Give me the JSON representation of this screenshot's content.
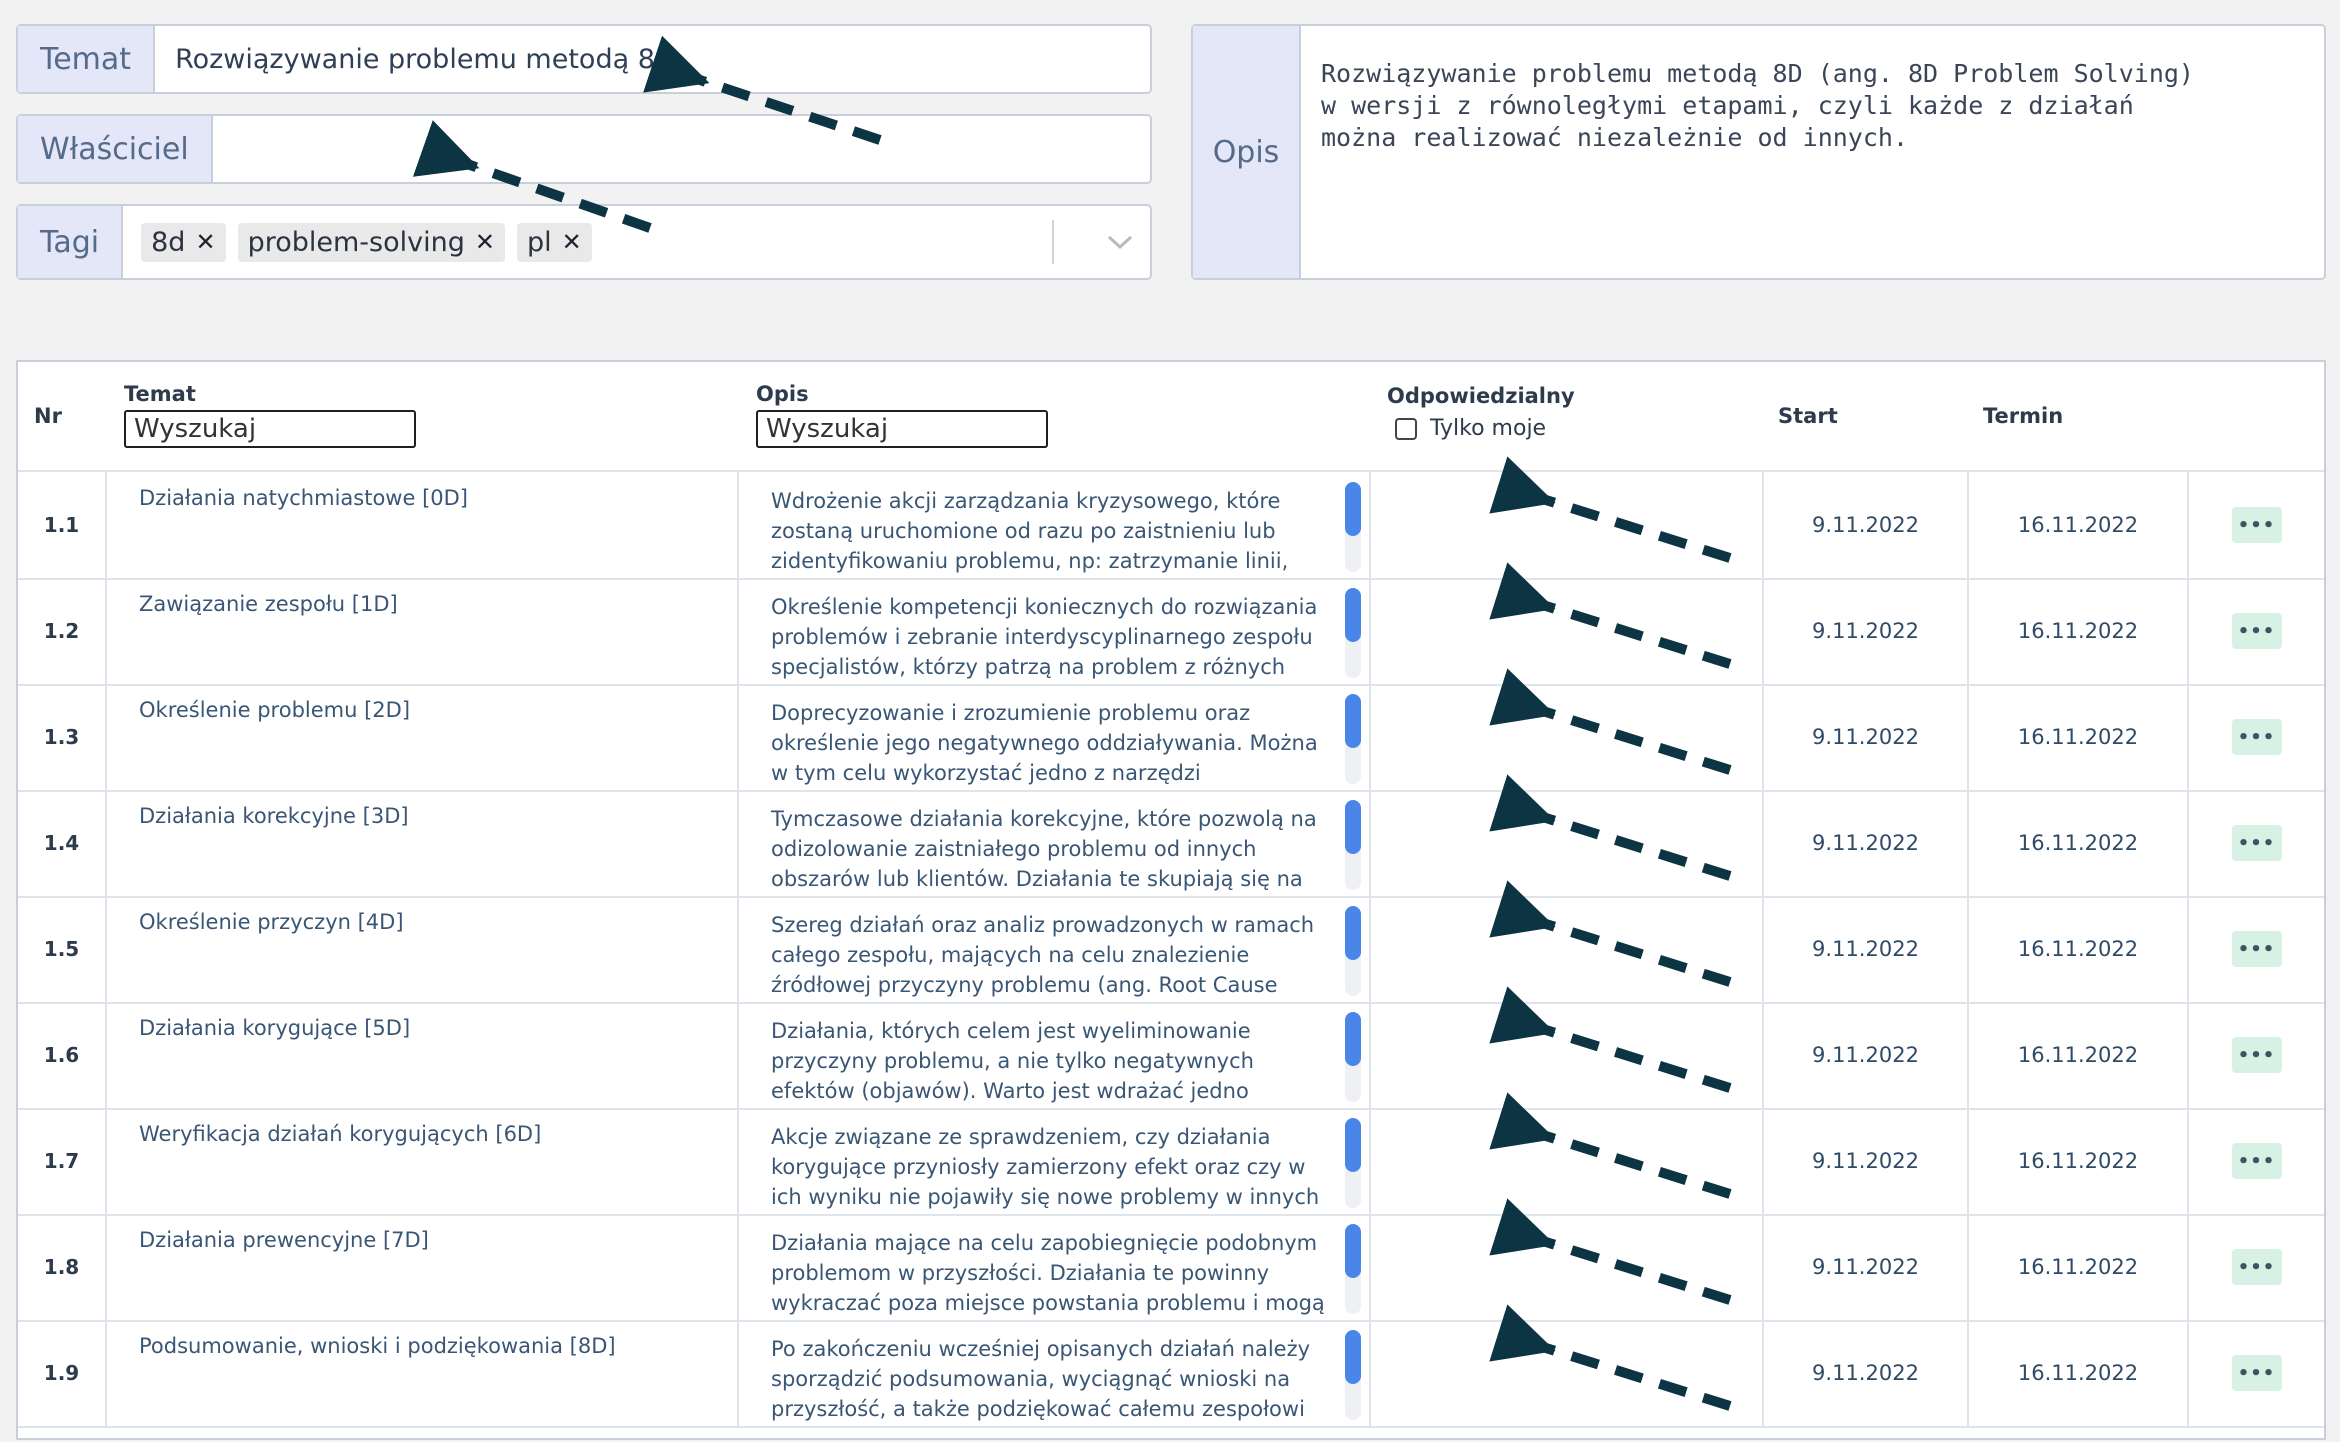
{
  "form": {
    "temat_label": "Temat",
    "temat_value": "Rozwiązywanie problemu metodą 8D",
    "wlasciciel_label": "Właściciel",
    "wlasciciel_value": "",
    "tagi_label": "Tagi",
    "tags": [
      "8d",
      "problem-solving",
      "pl"
    ],
    "opis_label": "Opis",
    "opis_value": "Rozwiązywanie problemu metodą 8D (ang. 8D Problem Solving)\nw wersji z równoległymi etapami, czyli każde z działań\nmożna realizować niezależnie od innych."
  },
  "table": {
    "headers": {
      "nr": "Nr",
      "temat": "Temat",
      "opis": "Opis",
      "odpowiedzialny": "Odpowiedzialny",
      "tylko_moje": "Tylko moje",
      "start": "Start",
      "termin": "Termin"
    },
    "search_placeholder": "Wyszukaj",
    "action_label": "•••",
    "rows": [
      {
        "nr": "1.1",
        "temat": "Działania natychmiastowe [0D]",
        "opis": "Wdrożenie akcji zarządzania kryzysowego, które zostaną uruchomione od razu po zaistnieniu lub zidentyfikowaniu problemu, np: zatrzymanie linii, wstrzymanie wysyłek lub",
        "start": "9.11.2022",
        "termin": "16.11.2022"
      },
      {
        "nr": "1.2",
        "temat": "Zawiązanie zespołu [1D]",
        "opis": "Określenie kompetencji koniecznych do rozwiązania problemów i zebranie interdyscyplinarnego zespołu specjalistów, którzy patrzą na problem z różnych punktów",
        "start": "9.11.2022",
        "termin": "16.11.2022"
      },
      {
        "nr": "1.3",
        "temat": "Określenie problemu [2D]",
        "opis": "Doprecyzowanie i zrozumienie problemu oraz określenie jego negatywnego oddziaływania. Można w tym celu wykorzystać jedno z narzędzi pomagających dookreślić",
        "start": "9.11.2022",
        "termin": "16.11.2022"
      },
      {
        "nr": "1.4",
        "temat": "Działania korekcyjne [3D]",
        "opis": "Tymczasowe działania korekcyjne, które pozwolą na odizolowanie zaistniałego problemu od innych obszarów lub klientów. Działania te skupiają się na eliminacji",
        "start": "9.11.2022",
        "termin": "16.11.2022"
      },
      {
        "nr": "1.5",
        "temat": "Określenie przyczyn [4D]",
        "opis": "Szereg działań oraz analiz prowadzonych w ramach całego zespołu, mających na celu znalezienie źródłowej przyczyny problemu (ang. Root Cause Analysis). W tym",
        "start": "9.11.2022",
        "termin": "16.11.2022"
      },
      {
        "nr": "1.6",
        "temat": "Działania korygujące [5D]",
        "opis": "Działania, których celem jest wyeliminowanie przyczyny problemu, a nie tylko negatywnych efektów (objawów). Warto jest wdrażać jedno działanie korygujące do jednej",
        "start": "9.11.2022",
        "termin": "16.11.2022"
      },
      {
        "nr": "1.7",
        "temat": "Weryfikacja działań korygujących [6D]",
        "opis": "Akcje związane ze sprawdzeniem, czy działania korygujące przyniosły zamierzony efekt oraz czy w ich wyniku nie pojawiły się nowe problemy w innych obszarach działania",
        "start": "9.11.2022",
        "termin": "16.11.2022"
      },
      {
        "nr": "1.8",
        "temat": "Działania prewencyjne [7D]",
        "opis": "Działania mające na celu zapobiegnięcie podobnym problemom w przyszłości. Działania te powinny wykraczać poza miejsce powstania problemu i mogą być",
        "start": "9.11.2022",
        "termin": "16.11.2022"
      },
      {
        "nr": "1.9",
        "temat": "Podsumowanie, wnioski i podziękowania [8D]",
        "opis": "Po zakończeniu wcześniej opisanych działań należy sporządzić podsumowania, wyciągnąć wnioski na przyszłość, a także podziękować całemu zespołowi za",
        "start": "9.11.2022",
        "termin": "16.11.2022"
      }
    ]
  },
  "colors": {
    "arrow": "#0c3443",
    "scroll_thumb": "#4a86e8",
    "action_button": "#d7f1e5",
    "label_bg": "#e3e7f8"
  },
  "icons": {
    "tag_remove": "close-icon",
    "tags_dropdown": "chevron-down-icon",
    "row_actions": "more-horizontal-icon"
  }
}
